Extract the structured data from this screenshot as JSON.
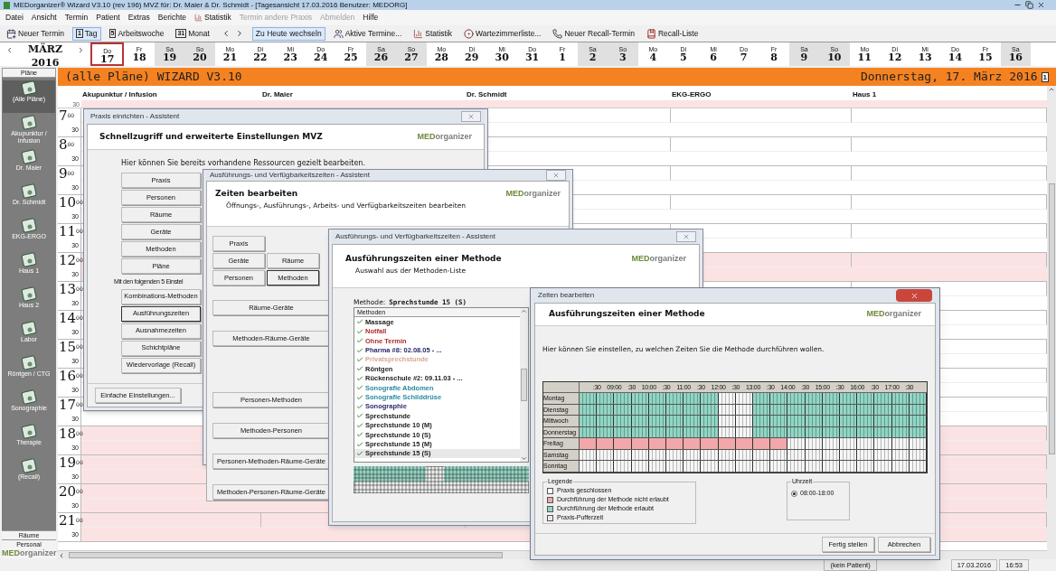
{
  "window": {
    "title": "MEDorganizer® Wizard V3.10 (rev 196) MVZ für: Dr. Maier & Dr. Schmidt - [Tagesansicht 17.03.2016    Benutzer: MEDORG]"
  },
  "menu": [
    {
      "label": "Datei",
      "disabled": false,
      "kind": "text"
    },
    {
      "label": "Ansicht",
      "disabled": false,
      "kind": "text"
    },
    {
      "label": "Termin",
      "disabled": false,
      "kind": "text"
    },
    {
      "label": "Patient",
      "disabled": false,
      "kind": "text"
    },
    {
      "label": "Extras",
      "disabled": false,
      "kind": "text"
    },
    {
      "label": "Berichte",
      "disabled": false,
      "kind": "text"
    },
    {
      "label": "Statistik",
      "disabled": false,
      "kind": "chart"
    },
    {
      "label": "Termin andere Praxis",
      "disabled": true,
      "kind": "text"
    },
    {
      "label": "Abmelden",
      "disabled": true,
      "kind": "text"
    },
    {
      "label": "Hilfe",
      "disabled": false,
      "kind": "text"
    }
  ],
  "toolbar": [
    {
      "kind": "calendar",
      "label": "Neuer Termin",
      "selected": false
    },
    {
      "kind": "number",
      "badge": "1",
      "label": "Tag",
      "selected": true
    },
    {
      "kind": "number",
      "badge": "5",
      "label": "Arbeitswoche",
      "selected": false
    },
    {
      "kind": "number",
      "badge": "31",
      "label": "Monat",
      "selected": false
    },
    {
      "kind": "arrows"
    },
    {
      "kind": "plain",
      "label": "Zu Heute wechseln",
      "selected": true
    },
    {
      "kind": "people",
      "label": "Aktive Termine...",
      "selected": false
    },
    {
      "kind": "chart",
      "label": "Statistik",
      "selected": false
    },
    {
      "kind": "clock",
      "label": "Wartezimmerliste...",
      "selected": false
    },
    {
      "kind": "phone",
      "label": "Neuer Recall-Termin",
      "selected": false
    },
    {
      "kind": "book",
      "label": "Recall-Liste",
      "selected": false
    }
  ],
  "month": {
    "name": "MÄRZ",
    "year": "2016"
  },
  "days": [
    {
      "dow": "Do",
      "day": "17",
      "weekend": false,
      "selected": true
    },
    {
      "dow": "Fr",
      "day": "18",
      "weekend": false,
      "selected": false
    },
    {
      "dow": "Sa",
      "day": "19",
      "weekend": true,
      "selected": false
    },
    {
      "dow": "So",
      "day": "20",
      "weekend": true,
      "selected": false
    },
    {
      "dow": "Mo",
      "day": "21",
      "weekend": false,
      "selected": false
    },
    {
      "dow": "Di",
      "day": "22",
      "weekend": false,
      "selected": false
    },
    {
      "dow": "Mi",
      "day": "23",
      "weekend": false,
      "selected": false
    },
    {
      "dow": "Do",
      "day": "24",
      "weekend": false,
      "selected": false
    },
    {
      "dow": "Fr",
      "day": "25",
      "weekend": false,
      "selected": false
    },
    {
      "dow": "Sa",
      "day": "26",
      "weekend": true,
      "selected": false
    },
    {
      "dow": "So",
      "day": "27",
      "weekend": true,
      "selected": false
    },
    {
      "dow": "Mo",
      "day": "28",
      "weekend": false,
      "selected": false
    },
    {
      "dow": "Di",
      "day": "29",
      "weekend": false,
      "selected": false
    },
    {
      "dow": "Mi",
      "day": "30",
      "weekend": false,
      "selected": false
    },
    {
      "dow": "Do",
      "day": "31",
      "weekend": false,
      "selected": false
    },
    {
      "dow": "Fr",
      "day": "1",
      "weekend": false,
      "selected": false
    },
    {
      "dow": "Sa",
      "day": "2",
      "weekend": true,
      "selected": false
    },
    {
      "dow": "So",
      "day": "3",
      "weekend": true,
      "selected": false
    },
    {
      "dow": "Mo",
      "day": "4",
      "weekend": false,
      "selected": false
    },
    {
      "dow": "Di",
      "day": "5",
      "weekend": false,
      "selected": false
    },
    {
      "dow": "Mi",
      "day": "6",
      "weekend": false,
      "selected": false
    },
    {
      "dow": "Do",
      "day": "7",
      "weekend": false,
      "selected": false
    },
    {
      "dow": "Fr",
      "day": "8",
      "weekend": false,
      "selected": false
    },
    {
      "dow": "Sa",
      "day": "9",
      "weekend": true,
      "selected": false
    },
    {
      "dow": "So",
      "day": "10",
      "weekend": true,
      "selected": false
    },
    {
      "dow": "Mo",
      "day": "11",
      "weekend": false,
      "selected": false
    },
    {
      "dow": "Di",
      "day": "12",
      "weekend": false,
      "selected": false
    },
    {
      "dow": "Mi",
      "day": "13",
      "weekend": false,
      "selected": false
    },
    {
      "dow": "Do",
      "day": "14",
      "weekend": false,
      "selected": false
    },
    {
      "dow": "Fr",
      "day": "15",
      "weekend": false,
      "selected": false
    },
    {
      "dow": "Sa",
      "day": "16",
      "weekend": true,
      "selected": false
    }
  ],
  "sidebar": {
    "title": "Pläne",
    "items": [
      {
        "label": "(Alle Pläne)",
        "selected": true
      },
      {
        "label": "Akupunktur / Infusion",
        "selected": false
      },
      {
        "label": "Dr. Maier",
        "selected": false
      },
      {
        "label": "Dr. Schmidt",
        "selected": false
      },
      {
        "label": "EKG-ERGO",
        "selected": false
      },
      {
        "label": "Haus 1",
        "selected": false
      },
      {
        "label": "Haus 2",
        "selected": false
      },
      {
        "label": "Labor",
        "selected": false
      },
      {
        "label": "Röntgen / CTG",
        "selected": false
      },
      {
        "label": "Sonographie",
        "selected": false
      },
      {
        "label": "Therapie",
        "selected": false
      },
      {
        "label": "(Recall)",
        "selected": false
      }
    ],
    "tabs": [
      "Räume",
      "Personal"
    ],
    "logo": {
      "bold": "MED",
      "rest": "organizer"
    }
  },
  "plan": {
    "title": "(alle Pläne) WIZARD V3.10",
    "date": "Donnerstag, 17. März 2016",
    "date_icon": "1",
    "columns": [
      "Akupunktur / Infusion",
      "Dr. Maier",
      "Dr. Schmidt",
      "EKG-ERGO",
      "Haus 1"
    ],
    "first_half": {
      "label": "30",
      "closed": true
    },
    "hours": [
      {
        "hour": "7",
        "min": "00",
        "half": "30",
        "closed": false
      },
      {
        "hour": "8",
        "min": "00",
        "half": "30",
        "closed": false
      },
      {
        "hour": "9",
        "min": "00",
        "half": "30",
        "closed": false
      },
      {
        "hour": "10",
        "min": "00",
        "half": "30",
        "closed": false
      },
      {
        "hour": "11",
        "min": "00",
        "half": "30",
        "closed": false
      },
      {
        "hour": "12",
        "min": "00",
        "half": "30",
        "closed": true
      },
      {
        "hour": "13",
        "min": "00",
        "half": "30",
        "closed": false
      },
      {
        "hour": "14",
        "min": "00",
        "half": "30",
        "closed": false
      },
      {
        "hour": "15",
        "min": "00",
        "half": "30",
        "closed": false
      },
      {
        "hour": "16",
        "min": "00",
        "half": "30",
        "closed": false
      },
      {
        "hour": "17",
        "min": "00",
        "half": "30",
        "closed": false
      },
      {
        "hour": "18",
        "min": "00",
        "half": "30",
        "closed": true
      },
      {
        "hour": "19",
        "min": "00",
        "half": "30",
        "closed": true
      },
      {
        "hour": "20",
        "min": "00",
        "half": "30",
        "closed": true
      },
      {
        "hour": "21",
        "min": "00",
        "half": "30",
        "closed": true
      }
    ]
  },
  "status_bar": [
    "(kein Patient)",
    "17.03.2016",
    "16:53"
  ],
  "dialog_setup": {
    "title": "Praxis einrichten - Assistent",
    "heading": "Schnellzugriff und erweiterte Einstellungen MVZ",
    "logo": {
      "bold": "MED",
      "rest": "organizer"
    },
    "intro": "Hier können Sie bereits vorhandene Ressourcen gezielt bearbeiten.",
    "buttons": [
      {
        "label": "Praxis",
        "focused": false
      },
      {
        "label": "Personen",
        "focused": false
      },
      {
        "label": "Räume",
        "focused": false
      },
      {
        "label": "Geräte",
        "focused": false
      },
      {
        "label": "Methoden",
        "focused": false
      },
      {
        "label": "Pläne",
        "focused": false
      }
    ],
    "section": "Mit den folgenden 5 Einstel",
    "buttons2": [
      {
        "label": "Kombinations-Methoden",
        "focused": false
      },
      {
        "label": "Ausführungszeiten",
        "focused": true
      },
      {
        "label": "Ausnahmezeiten",
        "focused": false
      },
      {
        "label": "Schichtpläne",
        "focused": false
      },
      {
        "label": "Wiedervorlage (Recall)",
        "focused": false
      }
    ],
    "footer_button": "Einfache Einstellungen..."
  },
  "dialog_times": {
    "title": "Ausführungs- und Verfügbarkeitszeiten - Assistent",
    "heading": "Zeiten bearbeiten",
    "subheading": "Öffnungs-, Ausführungs-, Arbeits- und Verfügbarkeitszeiten bearbeiten",
    "logo": {
      "bold": "MED",
      "rest": "organizer"
    },
    "button_rows": [
      [
        {
          "label": "Praxis",
          "focused": false
        }
      ],
      [
        {
          "label": "Geräte",
          "focused": false
        },
        {
          "label": "Räume",
          "focused": false
        }
      ],
      [
        {
          "label": "Personen",
          "focused": false
        },
        {
          "label": "Methoden",
          "focused": true
        }
      ]
    ],
    "wide_buttons": [
      {
        "label": "Räume-Geräte",
        "gap": false
      },
      {
        "label": "Methoden-Räume-Geräte",
        "gap": false
      },
      {
        "label": "Personen-Methoden",
        "gap": true
      },
      {
        "label": "Methoden-Personen",
        "gap": false
      },
      {
        "label": "Personen-Methoden-Räume-Geräte",
        "gap": false
      },
      {
        "label": "Methoden-Personen-Räume-Geräte",
        "gap": false
      }
    ]
  },
  "dialog_method": {
    "title": "Ausführungs- und Verfügbarkeitszeiten - Assistent",
    "heading": "Ausführungszeiten einer Methode",
    "subheading": "Auswahl aus der Methoden-Liste",
    "logo": {
      "bold": "MED",
      "rest": "organizer"
    },
    "method_label": "Methode:",
    "method_value": "Sprechstunde 15 (S)",
    "list_header": "Methoden",
    "methods": [
      {
        "name": "Massage",
        "color": "#222222",
        "selected": false
      },
      {
        "name": "Notfall",
        "color": "#b02a2a",
        "selected": false
      },
      {
        "name": "Ohne Termin",
        "color": "#b02a2a",
        "selected": false
      },
      {
        "name": "Pharma #8:  02.08.05 - ...",
        "color": "#28286e",
        "selected": false
      },
      {
        "name": "Privatsprechstunde",
        "color": "#d8a890",
        "selected": false
      },
      {
        "name": "Röntgen",
        "color": "#222222",
        "selected": false
      },
      {
        "name": "Rückenschule #2:  09.11.03 - ...",
        "color": "#222222",
        "selected": false
      },
      {
        "name": "Sonografie Abdomen",
        "color": "#2a8aa0",
        "selected": false
      },
      {
        "name": "Sonografie Schilddrüse",
        "color": "#2a8aa0",
        "selected": false
      },
      {
        "name": "Sonographie",
        "color": "#28286e",
        "selected": false
      },
      {
        "name": "Sprechstunde",
        "color": "#222222",
        "selected": false
      },
      {
        "name": "Sprechstunde 10 (M)",
        "color": "#222222",
        "selected": false
      },
      {
        "name": "Sprechstunde 10 (S)",
        "color": "#222222",
        "selected": false
      },
      {
        "name": "Sprechstunde 15 (M)",
        "color": "#222222",
        "selected": false
      },
      {
        "name": "Sprechstunde 15 (S)",
        "color": "#222222",
        "selected": true
      }
    ]
  },
  "dialog_edit": {
    "title": "Zeiten bearbeiten",
    "heading": "Ausführungszeiten einer Methode",
    "logo": {
      "bold": "MED",
      "rest": "organizer"
    },
    "intro": "Hier können Sie einstellen, zu welchen Zeiten Sie die Methode durchführen wollen.",
    "time_labels": [
      ":30",
      "09:00",
      ":30",
      "10:00",
      ":30",
      "11:00",
      ":30",
      "12:00",
      ":30",
      "13:00",
      ":30",
      "14:00",
      ":30",
      "15:00",
      ":30",
      "16:00",
      ":30",
      "17:00",
      ":30"
    ],
    "days": [
      {
        "name": "Montag",
        "slots": [
          {
            "kind": "open"
          },
          {
            "kind": "open"
          },
          {
            "kind": "open"
          },
          {
            "kind": "open"
          },
          {
            "kind": "open"
          },
          {
            "kind": "open"
          },
          {
            "kind": "open"
          },
          {
            "kind": "open"
          },
          {
            "kind": "closed"
          },
          {
            "kind": "closed"
          },
          {
            "kind": "open"
          },
          {
            "kind": "open"
          },
          {
            "kind": "open"
          },
          {
            "kind": "open"
          },
          {
            "kind": "open"
          },
          {
            "kind": "open"
          },
          {
            "kind": "open"
          },
          {
            "kind": "open"
          },
          {
            "kind": "open"
          },
          {
            "kind": "open"
          }
        ]
      },
      {
        "name": "Dienstag",
        "slots": [
          {
            "kind": "open"
          },
          {
            "kind": "open"
          },
          {
            "kind": "open"
          },
          {
            "kind": "open"
          },
          {
            "kind": "open"
          },
          {
            "kind": "open"
          },
          {
            "kind": "open"
          },
          {
            "kind": "open"
          },
          {
            "kind": "closed"
          },
          {
            "kind": "closed"
          },
          {
            "kind": "open"
          },
          {
            "kind": "open"
          },
          {
            "kind": "open"
          },
          {
            "kind": "open"
          },
          {
            "kind": "open"
          },
          {
            "kind": "open"
          },
          {
            "kind": "open"
          },
          {
            "kind": "open"
          },
          {
            "kind": "open"
          },
          {
            "kind": "open"
          }
        ]
      },
      {
        "name": "Mittwoch",
        "slots": [
          {
            "kind": "open"
          },
          {
            "kind": "open"
          },
          {
            "kind": "open"
          },
          {
            "kind": "open"
          },
          {
            "kind": "open"
          },
          {
            "kind": "open"
          },
          {
            "kind": "open"
          },
          {
            "kind": "open"
          },
          {
            "kind": "closed"
          },
          {
            "kind": "closed"
          },
          {
            "kind": "open"
          },
          {
            "kind": "open"
          },
          {
            "kind": "open"
          },
          {
            "kind": "open"
          },
          {
            "kind": "open"
          },
          {
            "kind": "open"
          },
          {
            "kind": "open"
          },
          {
            "kind": "open"
          },
          {
            "kind": "open"
          },
          {
            "kind": "open"
          }
        ]
      },
      {
        "name": "Donnerstag",
        "slots": [
          {
            "kind": "open"
          },
          {
            "kind": "open"
          },
          {
            "kind": "open"
          },
          {
            "kind": "open"
          },
          {
            "kind": "open"
          },
          {
            "kind": "open"
          },
          {
            "kind": "open"
          },
          {
            "kind": "open"
          },
          {
            "kind": "closed"
          },
          {
            "kind": "closed"
          },
          {
            "kind": "open"
          },
          {
            "kind": "open"
          },
          {
            "kind": "open"
          },
          {
            "kind": "open"
          },
          {
            "kind": "open"
          },
          {
            "kind": "open"
          },
          {
            "kind": "open"
          },
          {
            "kind": "open"
          },
          {
            "kind": "open"
          },
          {
            "kind": "open"
          }
        ]
      },
      {
        "name": "Freitag",
        "slots": [
          {
            "kind": "blocked"
          },
          {
            "kind": "blocked"
          },
          {
            "kind": "blocked"
          },
          {
            "kind": "blocked"
          },
          {
            "kind": "blocked"
          },
          {
            "kind": "blocked"
          },
          {
            "kind": "blocked"
          },
          {
            "kind": "blocked"
          },
          {
            "kind": "blocked"
          },
          {
            "kind": "blocked"
          },
          {
            "kind": "blocked"
          },
          {
            "kind": "blocked"
          },
          {
            "kind": "closed"
          },
          {
            "kind": "closed"
          },
          {
            "kind": "closed"
          },
          {
            "kind": "closed"
          },
          {
            "kind": "closed"
          },
          {
            "kind": "closed"
          },
          {
            "kind": "closed"
          },
          {
            "kind": "closed"
          }
        ]
      },
      {
        "name": "Samstag",
        "slots": [
          {
            "kind": "closed"
          },
          {
            "kind": "closed"
          },
          {
            "kind": "closed"
          },
          {
            "kind": "closed"
          },
          {
            "kind": "closed"
          },
          {
            "kind": "closed"
          },
          {
            "kind": "closed"
          },
          {
            "kind": "closed"
          },
          {
            "kind": "closed"
          },
          {
            "kind": "closed"
          },
          {
            "kind": "closed"
          },
          {
            "kind": "closed"
          },
          {
            "kind": "closed"
          },
          {
            "kind": "closed"
          },
          {
            "kind": "closed"
          },
          {
            "kind": "closed"
          },
          {
            "kind": "closed"
          },
          {
            "kind": "closed"
          },
          {
            "kind": "closed"
          },
          {
            "kind": "closed"
          }
        ]
      },
      {
        "name": "Sonntag",
        "slots": [
          {
            "kind": "closed"
          },
          {
            "kind": "closed"
          },
          {
            "kind": "closed"
          },
          {
            "kind": "closed"
          },
          {
            "kind": "closed"
          },
          {
            "kind": "closed"
          },
          {
            "kind": "closed"
          },
          {
            "kind": "closed"
          },
          {
            "kind": "closed"
          },
          {
            "kind": "closed"
          },
          {
            "kind": "closed"
          },
          {
            "kind": "closed"
          },
          {
            "kind": "closed"
          },
          {
            "kind": "closed"
          },
          {
            "kind": "closed"
          },
          {
            "kind": "closed"
          },
          {
            "kind": "closed"
          },
          {
            "kind": "closed"
          },
          {
            "kind": "closed"
          },
          {
            "kind": "closed"
          }
        ]
      }
    ],
    "legend_title": "Legende",
    "legend": [
      {
        "label": "Praxis geschlossen",
        "color": "#ffffff"
      },
      {
        "label": "Durchführung der Methode nicht erlaubt",
        "color": "#f2a7ab"
      },
      {
        "label": "Durchführung der Methode erlaubt",
        "color": "#93d5c4"
      },
      {
        "label": "Praxis-Pufferzeit",
        "color": "#fbe3e4"
      }
    ],
    "time_group": "Uhrzeit",
    "time_options": [
      {
        "label": "08:00-18:00",
        "selected": true
      }
    ],
    "buttons": [
      "Fertig stellen",
      "Abbrechen"
    ]
  }
}
